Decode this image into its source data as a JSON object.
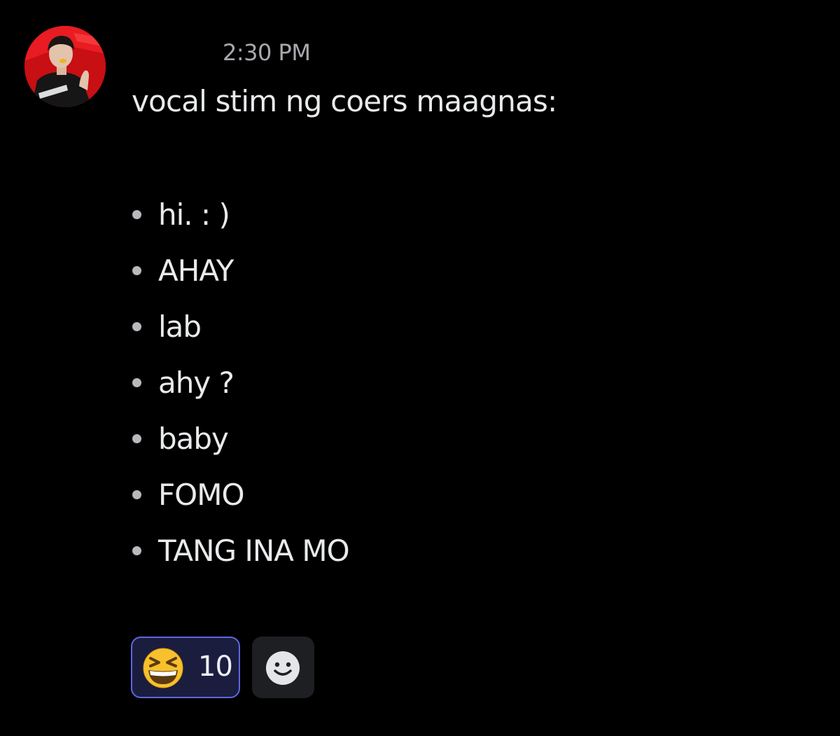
{
  "message": {
    "timestamp": "2:30 PM",
    "text": "vocal stim ng coers maagnas:",
    "list_items": [
      "hi. : )",
      "AHAY",
      "lab",
      "ahy ?",
      "baby",
      "FOMO",
      "TANG INA MO"
    ]
  },
  "reactions": [
    {
      "emoji_icon": "grinning-squinting-face-icon",
      "count": "10",
      "selected": true
    }
  ],
  "add_reaction": {
    "icon": "smiley-icon"
  },
  "colors": {
    "background": "#000000",
    "text": "#e9eaec",
    "timestamp": "#a7a9ae",
    "reaction_border": "#5e67e0",
    "reaction_bg": "#1b1d3f",
    "add_reaction_bg": "#1e1f22"
  }
}
